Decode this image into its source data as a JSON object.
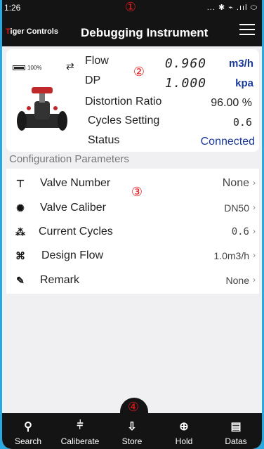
{
  "status_bar": {
    "time": "1:26",
    "icons": "... ✱ ⌁ .ııl ⬭"
  },
  "annotations": {
    "one": "①",
    "two": "②",
    "three": "③",
    "four": "④"
  },
  "app_bar": {
    "logo_t": "T",
    "logo_rest": "iger Controls",
    "title": "Debugging Instrument"
  },
  "device": {
    "battery_percent": "100%",
    "flow_label": "Flow",
    "flow_value": "0.960",
    "flow_unit": "m3/h",
    "dp_label": "DP",
    "dp_value": "1.000",
    "dp_unit": "kpa",
    "distortion_label": "Distortion Ratio",
    "distortion_value": "96.00 %",
    "cycles_label": "Cycles Setting",
    "cycles_value": "0.6",
    "status_label": "Status",
    "status_value": "Connected"
  },
  "config": {
    "section_title": "Configuration Parameters",
    "items": [
      {
        "label": "Valve Number",
        "value": "None"
      },
      {
        "label": "Valve Caliber",
        "value": "DN50"
      },
      {
        "label": "Current Cycles",
        "value": "0.6"
      },
      {
        "label": "Design Flow",
        "value": "1.0m3/h"
      },
      {
        "label": "Remark",
        "value": "None"
      }
    ]
  },
  "bottom_nav": [
    {
      "label": "Search",
      "icon": "search-icon"
    },
    {
      "label": "Caliberate",
      "icon": "calibrate-icon"
    },
    {
      "label": "Store",
      "icon": "store-icon"
    },
    {
      "label": "Hold",
      "icon": "lock-icon"
    },
    {
      "label": "Datas",
      "icon": "datas-icon"
    }
  ],
  "colors": {
    "accent_blue": "#1a3a9a",
    "brand_red": "#e21a1a",
    "bar_black": "#141414",
    "frame_blue": "#2aa8e0"
  }
}
